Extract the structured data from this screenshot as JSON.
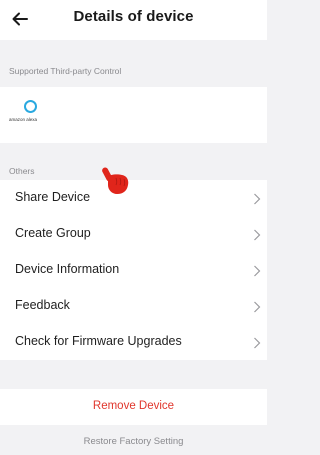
{
  "header": {
    "title": "Details of device",
    "back_icon": "arrow-left-icon"
  },
  "third_party": {
    "section_label": "Supported Third-party Control",
    "services": [
      {
        "name": "amazon alexa",
        "icon": "alexa-ring-icon",
        "brand_color": "#2aa9e0"
      }
    ]
  },
  "others": {
    "section_label": "Others",
    "items": [
      {
        "label": "Share Device"
      },
      {
        "label": "Create Group"
      },
      {
        "label": "Device Information"
      },
      {
        "label": "Feedback"
      },
      {
        "label": "Check for Firmware Upgrades"
      }
    ],
    "chevron_icon": "chevron-right-icon"
  },
  "actions": {
    "remove_label": "Remove Device",
    "remove_color": "#e0362c",
    "restore_label": "Restore Factory Setting"
  },
  "overlay": {
    "pointer_icon": "hand-pointer-icon",
    "pointer_color": "#e0251b"
  }
}
